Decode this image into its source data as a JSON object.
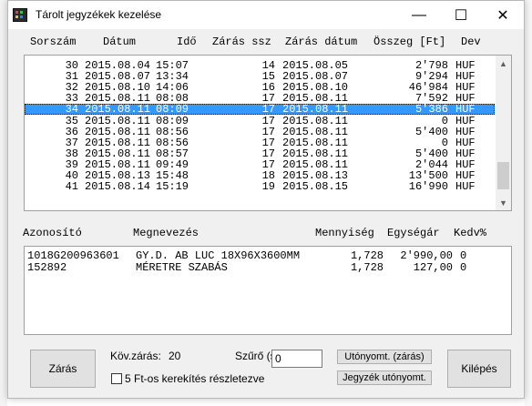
{
  "window": {
    "title": "Tárolt jegyzékek kezelése",
    "minimize": "—",
    "maximize": "☐",
    "close": "✕"
  },
  "columns": [
    "Sorszám",
    "Dátum",
    "Idő",
    "Zárás ssz",
    "Zárás dátum",
    "Összeg [Ft]",
    "Dev"
  ],
  "rows": [
    {
      "no": "30",
      "date": "2015.08.04",
      "time": "15:07",
      "zssz": "14",
      "zdate": "2015.08.05",
      "amount": "2'798",
      "dev": "HUF"
    },
    {
      "no": "31",
      "date": "2015.08.07",
      "time": "13:34",
      "zssz": "15",
      "zdate": "2015.08.07",
      "amount": "9'294",
      "dev": "HUF"
    },
    {
      "no": "32",
      "date": "2015.08.10",
      "time": "14:06",
      "zssz": "16",
      "zdate": "2015.08.10",
      "amount": "46'984",
      "dev": "HUF"
    },
    {
      "no": "33",
      "date": "2015.08.11",
      "time": "08:08",
      "zssz": "17",
      "zdate": "2015.08.11",
      "amount": "7'592",
      "dev": "HUF"
    },
    {
      "no": "34",
      "date": "2015.08.11",
      "time": "08:09",
      "zssz": "17",
      "zdate": "2015.08.11",
      "amount": "5'386",
      "dev": "HUF",
      "selected": true
    },
    {
      "no": "35",
      "date": "2015.08.11",
      "time": "08:09",
      "zssz": "17",
      "zdate": "2015.08.11",
      "amount": "0",
      "dev": "HUF"
    },
    {
      "no": "36",
      "date": "2015.08.11",
      "time": "08:56",
      "zssz": "17",
      "zdate": "2015.08.11",
      "amount": "5'400",
      "dev": "HUF"
    },
    {
      "no": "37",
      "date": "2015.08.11",
      "time": "08:56",
      "zssz": "17",
      "zdate": "2015.08.11",
      "amount": "0",
      "dev": "HUF"
    },
    {
      "no": "38",
      "date": "2015.08.11",
      "time": "08:57",
      "zssz": "17",
      "zdate": "2015.08.11",
      "amount": "5'400",
      "dev": "HUF"
    },
    {
      "no": "39",
      "date": "2015.08.11",
      "time": "09:49",
      "zssz": "17",
      "zdate": "2015.08.11",
      "amount": "2'044",
      "dev": "HUF"
    },
    {
      "no": "40",
      "date": "2015.08.13",
      "time": "15:48",
      "zssz": "18",
      "zdate": "2015.08.13",
      "amount": "13'500",
      "dev": "HUF"
    },
    {
      "no": "41",
      "date": "2015.08.14",
      "time": "15:19",
      "zssz": "19",
      "zdate": "2015.08.15",
      "amount": "16'990",
      "dev": "HUF"
    }
  ],
  "detail_columns": [
    "Azonosító",
    "Megnevezés",
    "Mennyiség",
    "Egységár",
    "Kedv%"
  ],
  "detail_rows": [
    {
      "id": "1018G200963601",
      "name": "GY.D. AB LUC 18X96X3600MM",
      "qty": "1,728",
      "price": "2'990,00",
      "disc": "0"
    },
    {
      "id": "152892",
      "name": "MÉRETRE SZABÁS",
      "qty": "1,728",
      "price": "127,00",
      "disc": "0"
    }
  ],
  "footer": {
    "close_button": "Zárás",
    "next_close_label": "Köv.zárás:",
    "next_close_value": "20",
    "filter_label": "Szűrő (ssz)",
    "filter_value": "0",
    "reprint_close_button": "Utónyomt. (zárás)",
    "reprint_list_button": "Jegyzék utónyomt.",
    "exit_button": "Kilépés",
    "rounding_checkbox_label": "5 Ft-os kerekítés részletezve",
    "rounding_checked": false
  },
  "icons": {
    "scroll_up": "up-arrow-icon",
    "scroll_down": "down-arrow-icon",
    "app": "app-icon"
  }
}
